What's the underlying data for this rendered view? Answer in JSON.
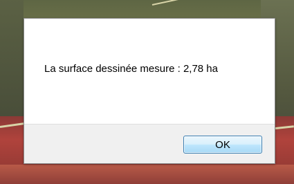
{
  "dialog": {
    "message": "La surface dessinée mesure : 2,78 ha",
    "ok_label": "OK"
  },
  "colors": {
    "dialog_body": "#ffffff",
    "dialog_footer": "#f0f0f0",
    "button_border": "#3c7fb1"
  }
}
